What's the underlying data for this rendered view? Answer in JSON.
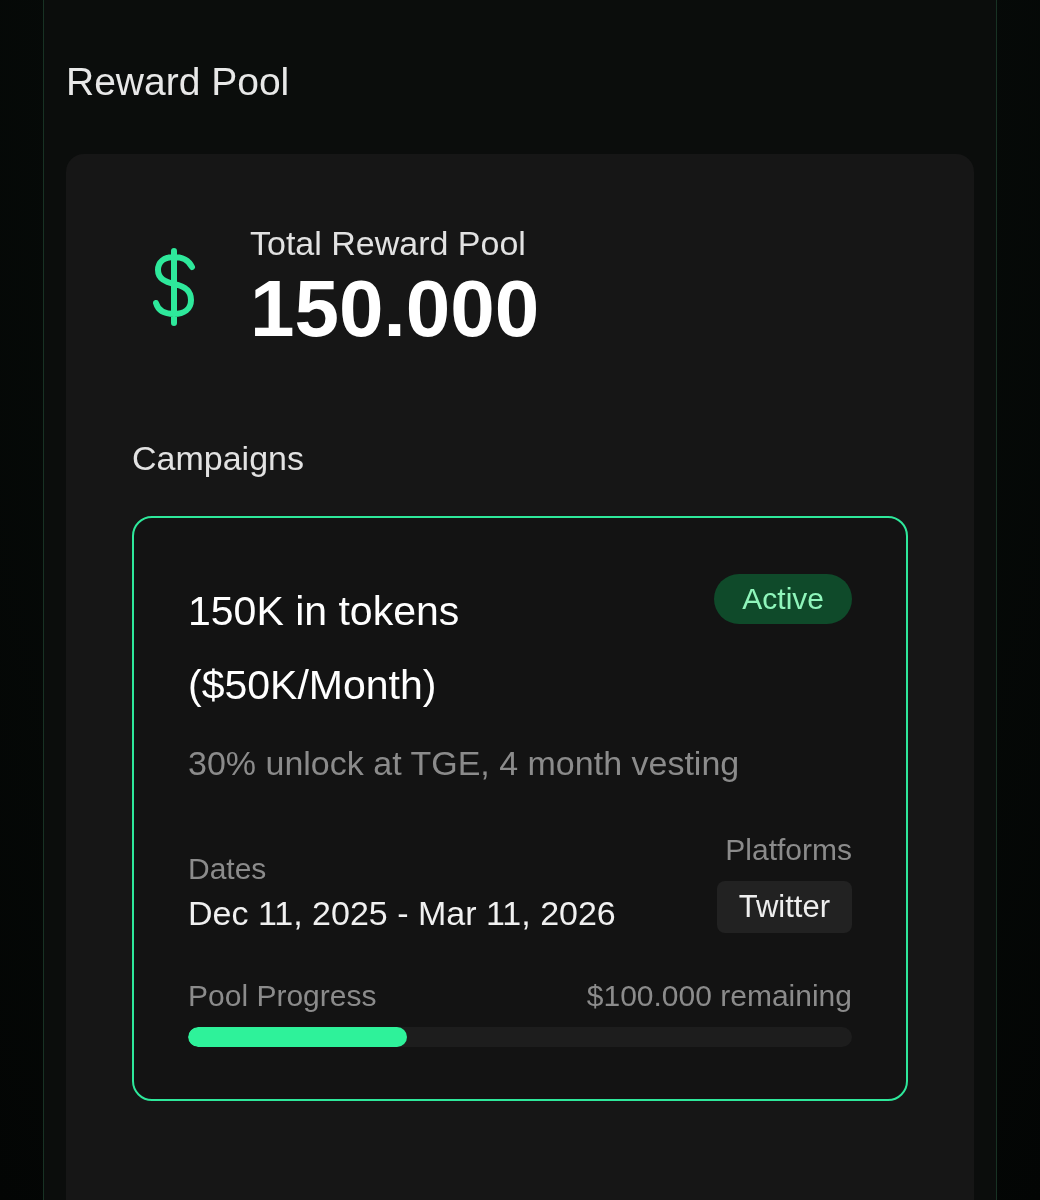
{
  "section": {
    "title": "Reward Pool"
  },
  "total": {
    "label": "Total Reward Pool",
    "amount": "150.000"
  },
  "campaigns_heading": "Campaigns",
  "campaigns": [
    {
      "title": "150K in tokens ($50K/Month)",
      "status": "Active",
      "active": true,
      "description": "30% unlock at TGE, 4 month vesting",
      "dates_label": "Dates",
      "dates": "Dec 11, 2025 - Mar 11, 2026",
      "platforms_label": "Platforms",
      "platforms": [
        "Twitter"
      ],
      "progress_label": "Pool Progress",
      "remaining": "$100.000 remaining",
      "level": 0.33
    }
  ]
}
